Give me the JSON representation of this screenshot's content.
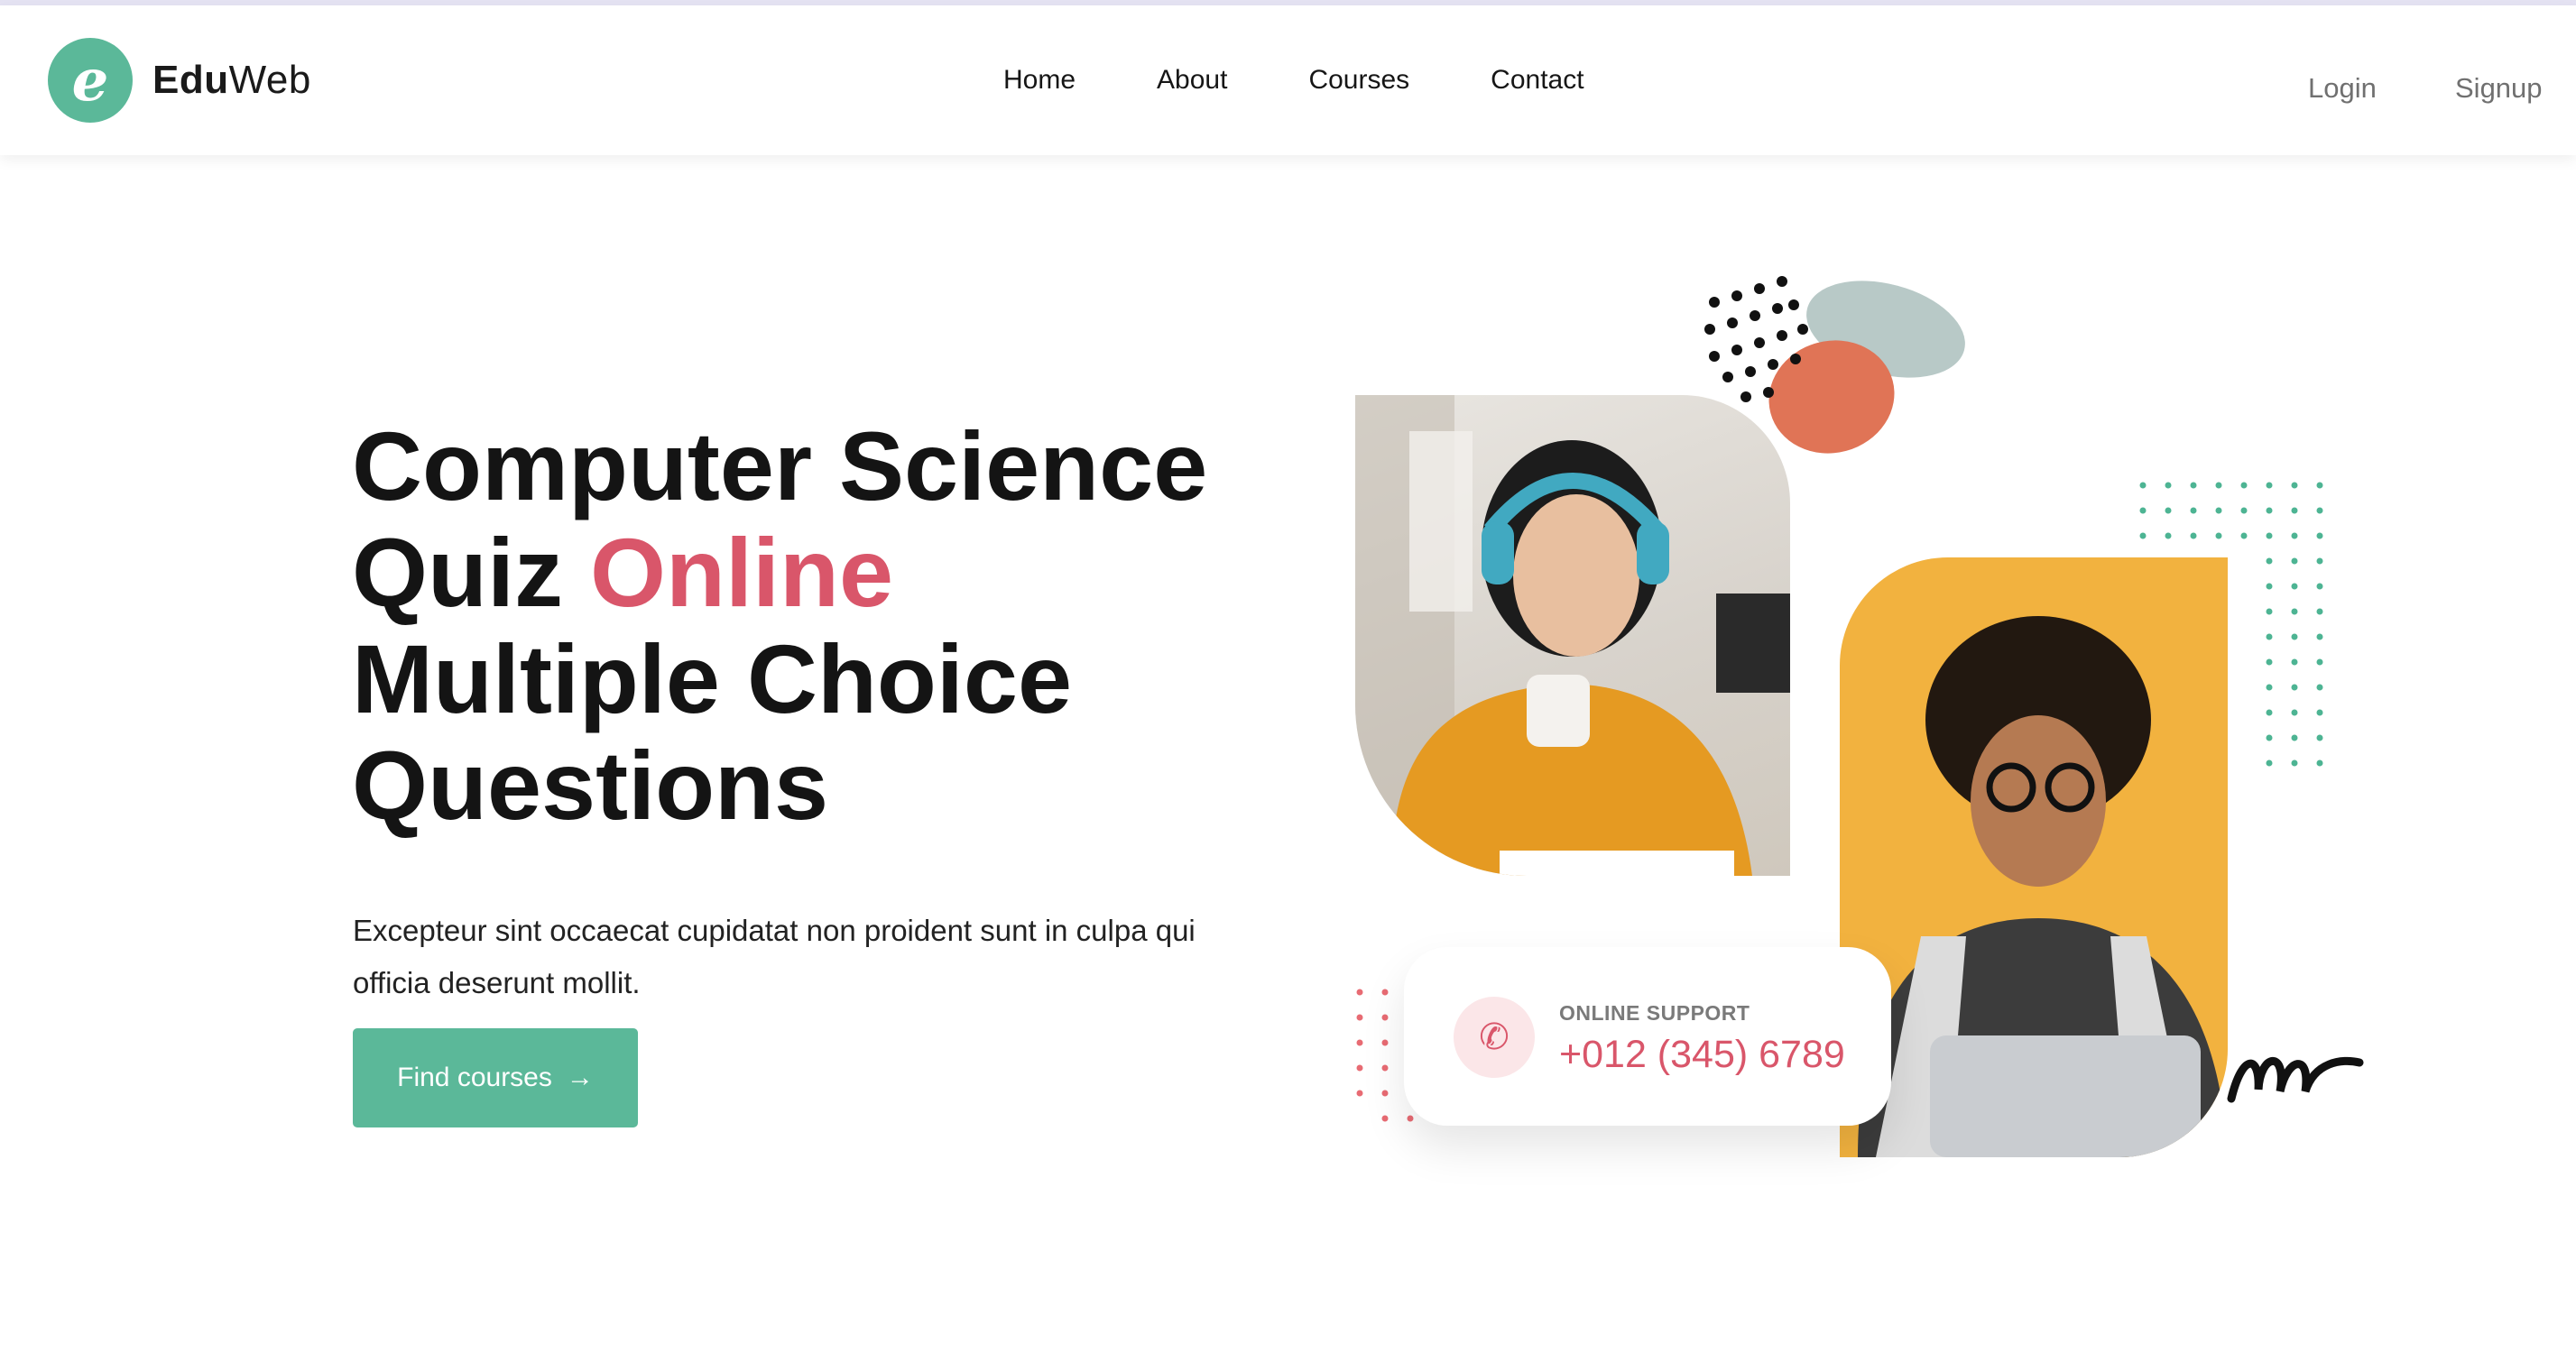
{
  "brand": {
    "name_bold": "Edu",
    "name_light": "Web",
    "logo_letter": "e",
    "color": "#5bb899"
  },
  "nav": {
    "items": [
      "Home",
      "About",
      "Courses",
      "Contact"
    ]
  },
  "auth": {
    "login": "Login",
    "signup": "Signup"
  },
  "hero": {
    "title_line1": "Computer Science",
    "title_line2_prefix": "Quiz ",
    "title_line2_accent": "Online",
    "title_line3": "Multiple Choice",
    "title_line4": "Questions",
    "description": "Excepteur sint occaecat cupidatat non proident sunt in culpa qui officia deserunt mollit.",
    "cta_label": "Find courses",
    "accent_color": "#d9566a"
  },
  "support": {
    "label": "ONLINE SUPPORT",
    "phone": "+012 (345) 6789"
  },
  "icons": [
    "eduweb-logo-icon",
    "arrow-right-icon",
    "phone-icon"
  ]
}
